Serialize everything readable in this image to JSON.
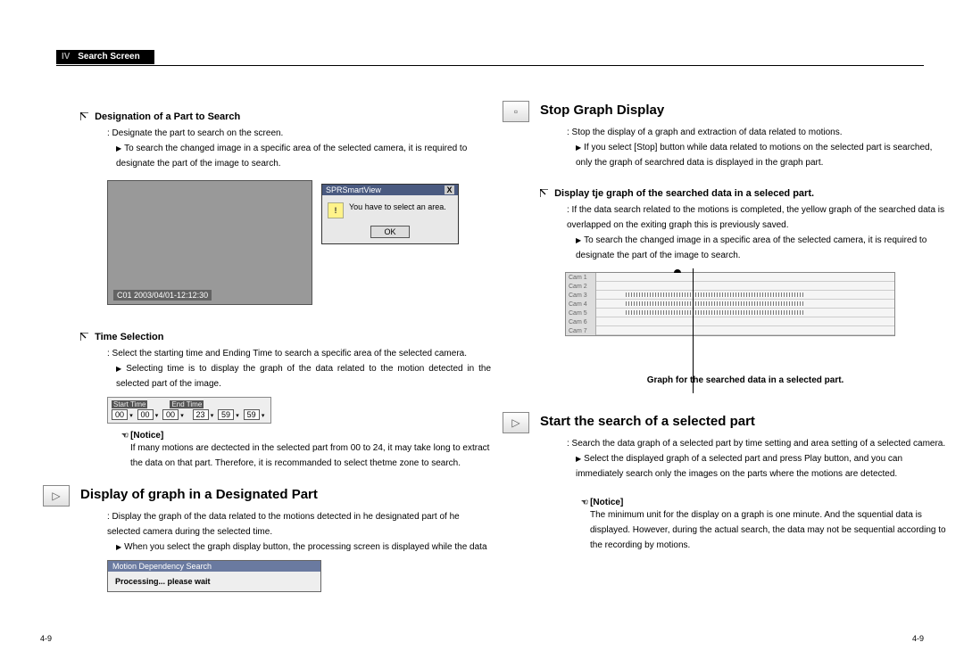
{
  "header": {
    "section_num": "IV",
    "section_title": "Search Screen"
  },
  "page_number": "4-9",
  "left": {
    "sub1_title": "Designation of a Part to Search",
    "sub1_colon": ": Designate the part to search on the screen.",
    "sub1_tri": "To search the changed image in a specific area of the selected camera, it is required to designate the part of the image to search.",
    "surveil_caption": "C01 2003/04/01-12:12:30",
    "dialog_title": "SPRSmartView",
    "dialog_msg": "You have to select an area.",
    "dialog_ok": "OK",
    "sub2_title": "Time Selection",
    "sub2_colon": ": Select the starting time and Ending Time to search a specific area of the selected camera.",
    "sub2_tri": "Selecting time is to display the graph of the data related to the motion detected in the selected part of the image.",
    "time_start_label": "Start Time",
    "time_end_label": "End Time",
    "time_start": [
      "00",
      "00",
      "00"
    ],
    "time_end": [
      "23",
      "59",
      "59"
    ],
    "notice_label": "[Notice]",
    "notice_body": "If many motions are dectected in the selected part from 00 to 24, it may take long to extract the data on that part. Therefore, it is recommanded to select thetme zone to search.",
    "sec1_title": "Display of graph in a Designated Part",
    "sec1_colon": ": Display the graph of the data related to the motions detected in he designated part of he selected camera during the selected time.",
    "sec1_tri": "When you select the graph display button, the processing screen is displayed while the data",
    "progress_title": "Motion Dependency Search",
    "progress_msg": "Processing... please wait"
  },
  "right": {
    "sec2_title": "Stop Graph Display",
    "sec2_colon": ": Stop the display of a graph and extraction of data related to motions.",
    "sec2_tri": "If you select [Stop] button while data related to motions on the selected part is searched, only the graph of searchred data is displayed in the graph part.",
    "sub3_title": "Display tje graph of the searched data in a seleced part.",
    "sub3_colon": ": If the data search related to the motions is completed, the yellow graph of the searched data is overlapped on the exiting graph this is previously saved.",
    "sub3_tri": "To search the changed image in a specific area of the selected camera, it is required to designate the part of the image to search.",
    "graph_rows": [
      "Cam 1",
      "Cam 2",
      "Cam 3",
      "Cam 4",
      "Cam 5",
      "Cam 6",
      "Cam 7"
    ],
    "graph_caption": "Graph for the searched data in a selected part.",
    "sec3_title": "Start the search of a selected part",
    "sec3_colon": ": Search the data graph of a selected part by time setting and area setting of a selected camera.",
    "sec3_tri": "Select the displayed graph of a selected part and press Play button, and you can immediately search only the images on the parts where the motions are detected.",
    "notice2_label": "[Notice]",
    "notice2_body": "The minimum unit for the display on a graph is one minute. And the squential data is displayed. However, during the actual search, the data may not be sequential according to the recording by motions."
  }
}
